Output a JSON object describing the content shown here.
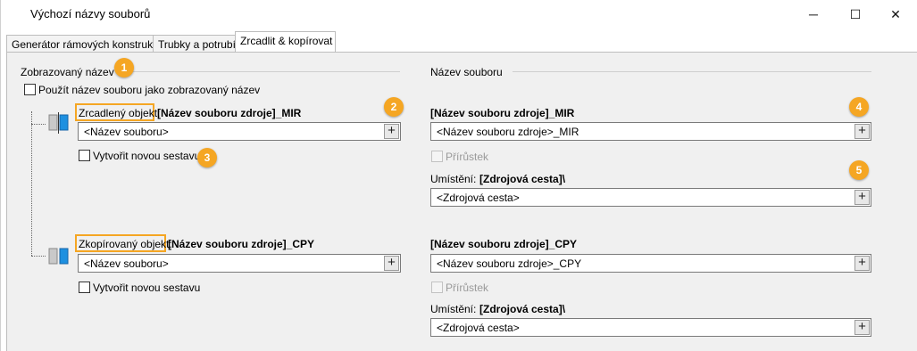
{
  "window": {
    "title": "Výchozí názvy souborů",
    "controls": {
      "minimize": "─",
      "maximize": "☐",
      "close": "✕"
    }
  },
  "tabs": [
    "Generátor rámových konstrukcí",
    "Trubky a potrubí",
    "Zrcadlit & kopírovat"
  ],
  "left": {
    "group_title": "Zobrazovaný název",
    "use_filename_checkbox": "Použít název souboru jako zobrazovaný název",
    "mirrored": {
      "label": "Zrcadlený objekt:",
      "value": "[Název souboru zdroje]_MIR",
      "field": "<Název souboru>",
      "plus": "+",
      "new_assembly": "Vytvořit novou sestavu"
    },
    "copied": {
      "label": "Zkopírovaný objekt:",
      "value": "[Název souboru zdroje]_CPY",
      "field": "<Název souboru>",
      "plus": "+",
      "new_assembly": "Vytvořit novou sestavu"
    }
  },
  "right": {
    "group_title": "Název souboru",
    "mirrored": {
      "heading": "[Název souboru zdroje]_MIR",
      "field": "<Název souboru zdroje>_MIR",
      "plus": "+",
      "increment": "Přírůstek",
      "location_label": "Umístění:",
      "location_value": "[Zdrojová cesta]\\",
      "location_field": "<Zdrojová cesta>"
    },
    "copied": {
      "heading": "[Název souboru zdroje]_CPY",
      "field": "<Název souboru zdroje>_CPY",
      "plus": "+",
      "increment": "Přírůstek",
      "location_label": "Umístění:",
      "location_value": "[Zdrojová cesta]\\",
      "location_field": "<Zdrojová cesta>"
    }
  },
  "callouts": [
    "1",
    "2",
    "3",
    "4",
    "5"
  ],
  "colors": {
    "callout": "#f5a623",
    "panel_bg": "#f0f0f0"
  },
  "icons": {
    "mirror": "mirror-part-icon",
    "copy": "copy-part-icon"
  }
}
